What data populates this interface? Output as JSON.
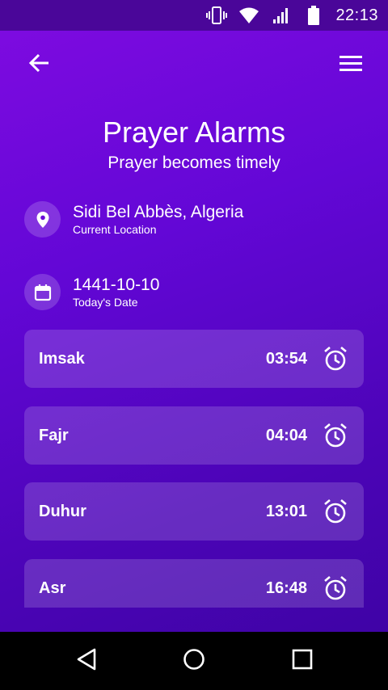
{
  "status_bar": {
    "time": "22:13",
    "icons": [
      "vibrate-icon",
      "wifi-icon",
      "signal-icon",
      "battery-icon"
    ]
  },
  "toolbar": {
    "back_icon": "arrow-back-icon",
    "menu_icon": "hamburger-menu-icon"
  },
  "header": {
    "title": "Prayer Alarms",
    "subtitle": "Prayer becomes timely"
  },
  "location": {
    "icon": "location-pin-icon",
    "value": "Sidi Bel Abbès, Algeria",
    "label": "Current Location"
  },
  "date": {
    "icon": "calendar-icon",
    "value": "1441-10-10",
    "label": "Today's Date"
  },
  "prayers": [
    {
      "name": "Imsak",
      "time": "03:54",
      "icon": "alarm-clock-icon"
    },
    {
      "name": "Fajr",
      "time": "04:04",
      "icon": "alarm-clock-icon"
    },
    {
      "name": "Duhur",
      "time": "13:01",
      "icon": "alarm-clock-icon"
    },
    {
      "name": "Asr",
      "time": "16:48",
      "icon": "alarm-clock-icon"
    }
  ],
  "nav_bar": {
    "icons": [
      "back-triangle-icon",
      "home-circle-icon",
      "recents-square-icon"
    ]
  },
  "colors": {
    "status_bar": "#4a0699",
    "gradient_top": "#7d0be0",
    "gradient_bottom": "#3f03a6",
    "card": "rgba(255,255,255,0.16)",
    "text": "#ffffff"
  }
}
